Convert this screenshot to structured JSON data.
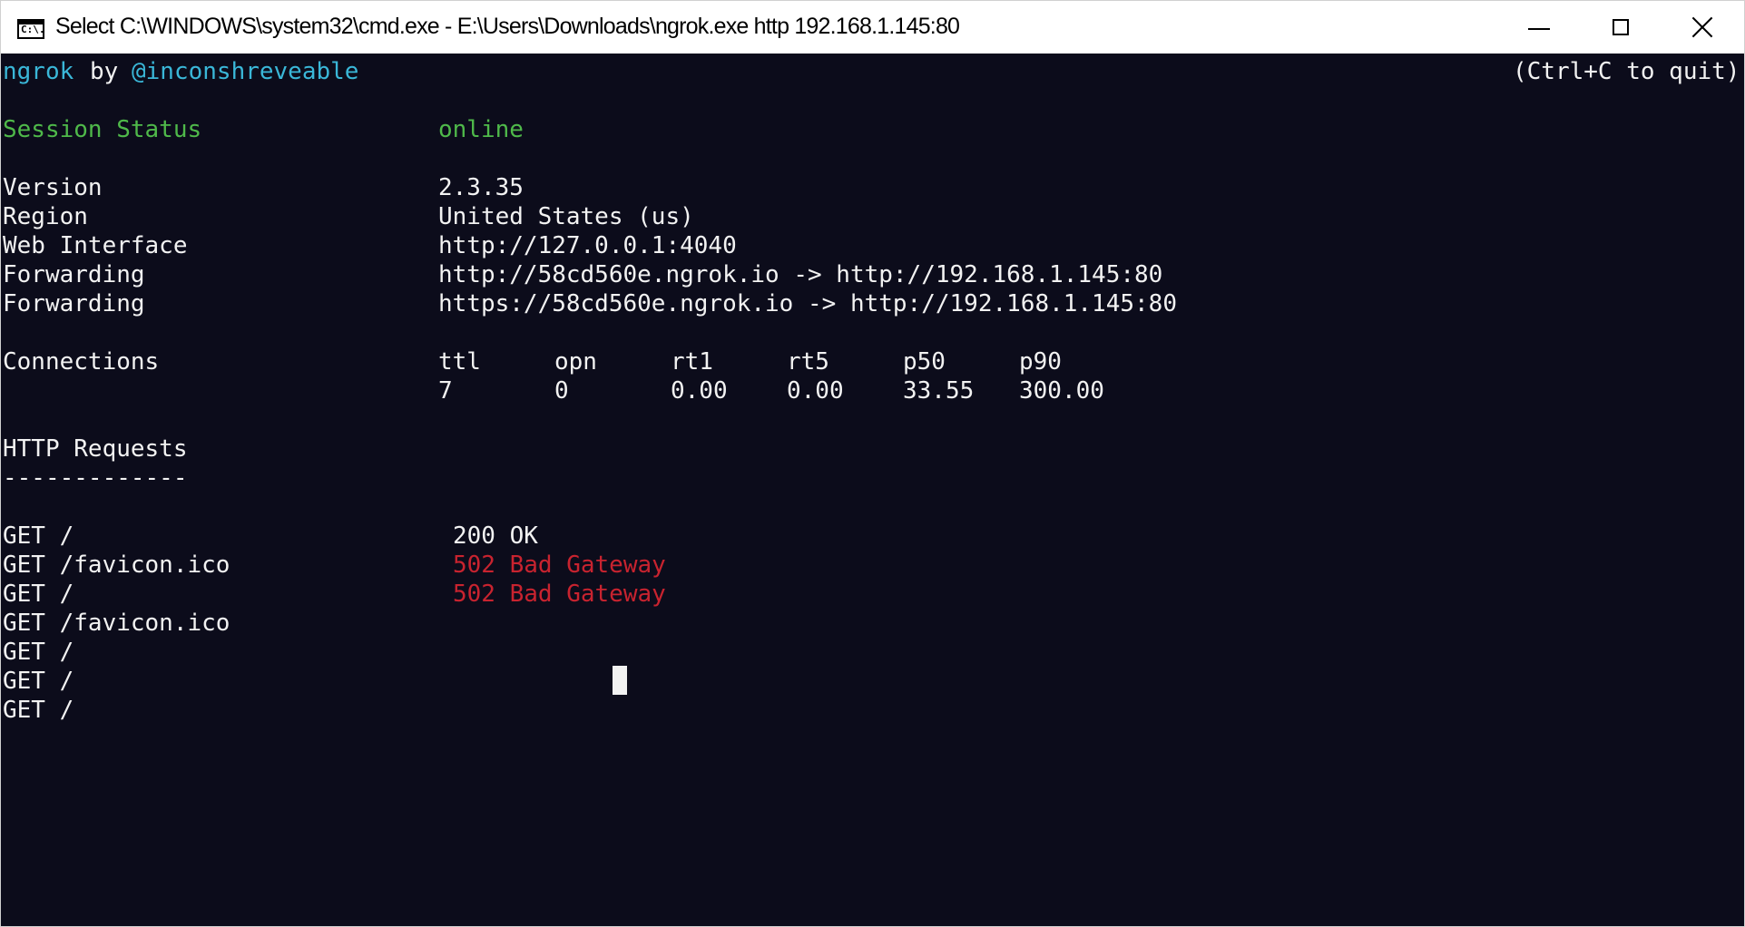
{
  "window": {
    "title": "Select C:\\WINDOWS\\system32\\cmd.exe - E:\\Users\\Downloads\\ngrok.exe  http 192.168.1.145:80",
    "icon": "cmd-icon",
    "icon_text": "C:\\."
  },
  "header": {
    "brand": "ngrok",
    "by": "by",
    "author": "@inconshreveable",
    "quit_hint": "(Ctrl+C to quit)"
  },
  "session": {
    "status_label": "Session Status",
    "status_value": "online",
    "version_label": "Version",
    "version_value": "2.3.35",
    "region_label": "Region",
    "region_value": "United States (us)",
    "web_label": "Web Interface",
    "web_value": "http://127.0.0.1:4040",
    "forwarding": [
      {
        "label": "Forwarding",
        "value": "http://58cd560e.ngrok.io -> http://192.168.1.145:80"
      },
      {
        "label": "Forwarding",
        "value": "https://58cd560e.ngrok.io -> http://192.168.1.145:80"
      }
    ]
  },
  "connections": {
    "label": "Connections",
    "headers": [
      "ttl",
      "opn",
      "rt1",
      "rt5",
      "p50",
      "p90"
    ],
    "values": [
      "7",
      "0",
      "0.00",
      "0.00",
      "33.55",
      "300.00"
    ]
  },
  "http": {
    "title": "HTTP Requests",
    "underline": "-------------",
    "requests": [
      {
        "request": "GET /",
        "status": "200 OK"
      },
      {
        "request": "GET /favicon.ico",
        "status": "502 Bad Gateway"
      },
      {
        "request": "GET /",
        "status": "502 Bad Gateway"
      },
      {
        "request": "GET /favicon.ico",
        "status": ""
      },
      {
        "request": "GET /",
        "status": ""
      },
      {
        "request": "GET /",
        "status": ""
      },
      {
        "request": "GET /",
        "status": ""
      }
    ]
  },
  "colors": {
    "background": "#0c0c1b",
    "text": "#f2f2f2",
    "online": "#4fb94a",
    "brand": "#3ab7d8",
    "error": "#c8232f"
  }
}
